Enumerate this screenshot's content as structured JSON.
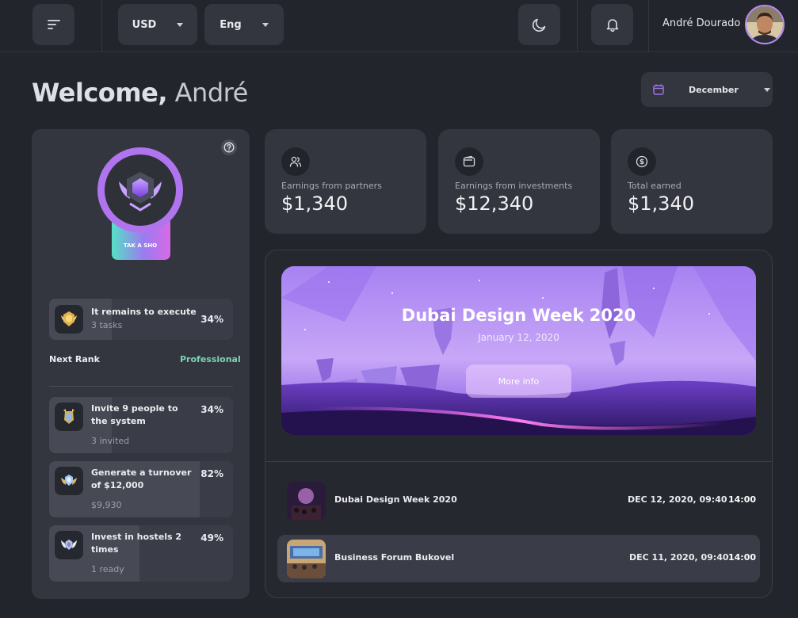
{
  "header": {
    "currency": "USD",
    "language": "Eng",
    "user_name": "André Dourado"
  },
  "welcome": {
    "greeting": "Welcome,",
    "name": "André"
  },
  "month_selector": "December",
  "rank_card": {
    "badge_text": "TAK A SHO",
    "current_task": {
      "title": "It remains to execute",
      "subtitle": "3 tasks",
      "percent": "34%",
      "progress": 0.34
    },
    "next_rank_label": "Next Rank",
    "next_rank_value": "Professional",
    "tasks": [
      {
        "title": "Invite 9 people to the system",
        "subtitle": "3 invited",
        "percent": "34%",
        "progress": 0.34
      },
      {
        "title": "Generate a turnover of $12,000",
        "subtitle": "$9,930",
        "percent": "82%",
        "progress": 0.82
      },
      {
        "title": "Invest in hostels 2 times",
        "subtitle": "1 ready",
        "percent": "49%",
        "progress": 0.49
      }
    ]
  },
  "stats": [
    {
      "label": "Earnings from partners",
      "value": "$1,340",
      "icon": "users-icon"
    },
    {
      "label": "Earnings from investments",
      "value": "$12,340",
      "icon": "wallet-icon"
    },
    {
      "label": "Total earned",
      "value": "$1,340",
      "icon": "dollar-icon"
    }
  ],
  "banner": {
    "title": "Dubai Design Week 2020",
    "date": "January 12, 2020",
    "button": "More info"
  },
  "events": [
    {
      "name": "Dubai Design Week 2020",
      "date": "DEC 12, 2020, 09:40",
      "time": "14:00"
    },
    {
      "name": "Business Forum Bukovel",
      "date": "DEC 11, 2020, 09:40",
      "time": "14:00"
    }
  ],
  "colors": {
    "background": "#23252d",
    "card": "#33363f",
    "accent_purple": "#b58cf7",
    "accent_green": "#7ad3b0"
  }
}
